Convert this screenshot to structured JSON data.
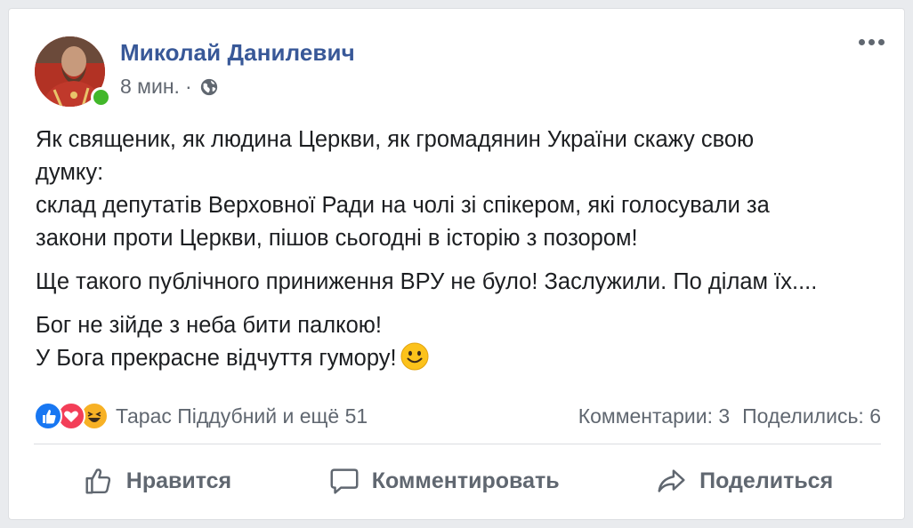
{
  "post": {
    "author": "Миколай Данилевич",
    "time": "8 мин.",
    "separator": "·",
    "privacy_icon": "globe-icon",
    "text": {
      "p1_line1": "Як священик, як людина Церкви, як громадянин України скажу свою",
      "p1_line2": "думку:",
      "p1_line3": "склад депутатів Верховної Ради на чолі зі спікером, які голосували за",
      "p1_line4": "закони проти Церкви, пішов сьогодні в історію з позором!",
      "p2": "Ще такого публічного приниження ВРУ не було! Заслужили. По ділам їх....",
      "p3_line1": "Бог не зійде з неба бити палкою!",
      "p3_line2": "У Бога прекрасне відчуття гумору!"
    }
  },
  "reactions": {
    "icons": [
      "like-icon",
      "love-icon",
      "haha-icon"
    ],
    "summary": "Тарас Піддубний и ещё 51",
    "comments": "Комментарии: 3",
    "shares": "Поделились: 6"
  },
  "actions": {
    "like": "Нравится",
    "comment": "Комментировать",
    "share": "Поделиться"
  },
  "colors": {
    "author_link": "#385898",
    "secondary_text": "#606770",
    "online": "#42b72a",
    "like": "#1877f2",
    "love": "#f33e58",
    "haha": "#f7b125"
  }
}
